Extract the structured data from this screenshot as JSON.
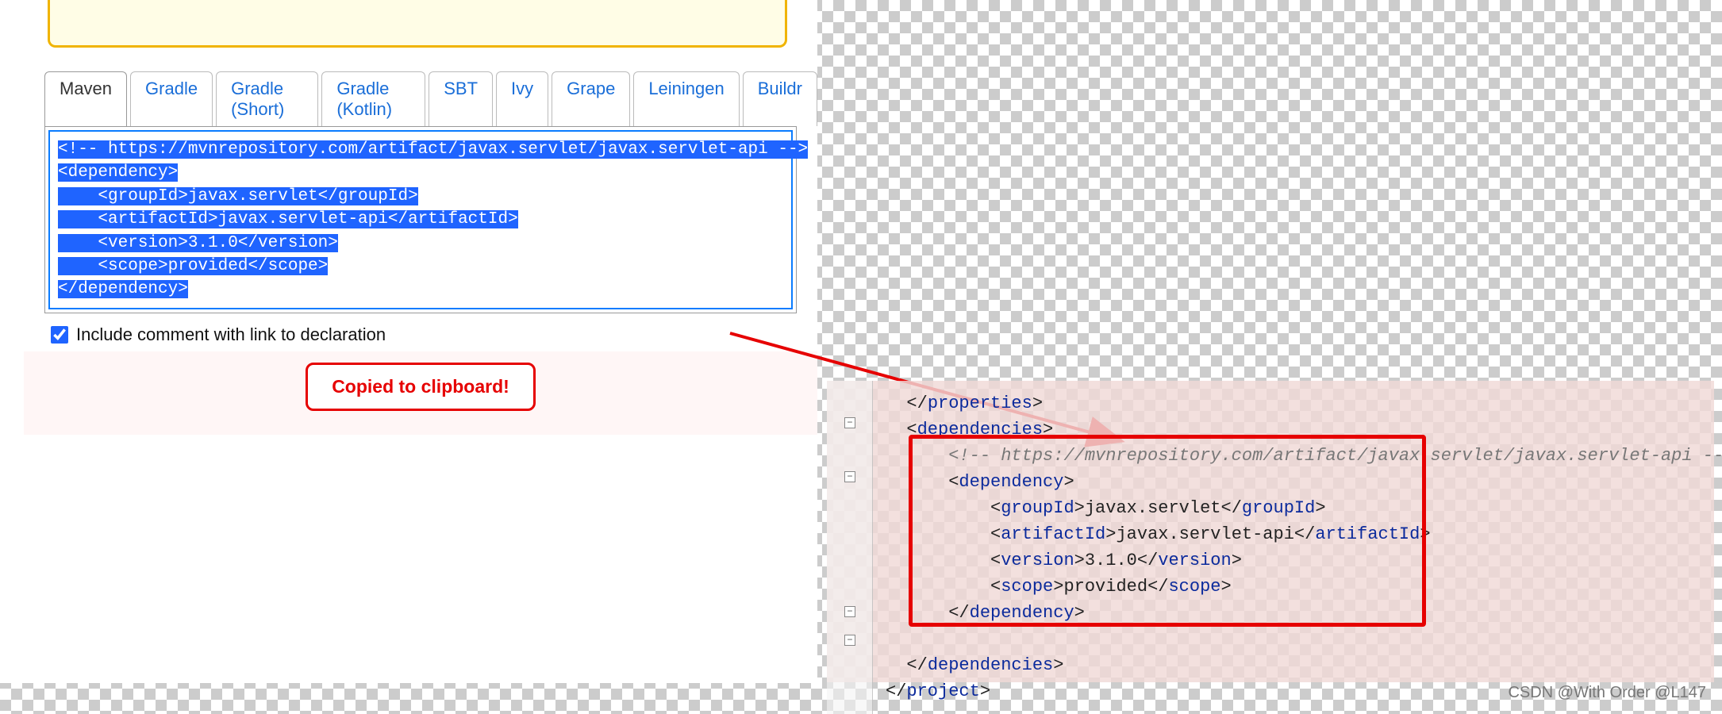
{
  "tabs": {
    "maven": "Maven",
    "gradle": "Gradle",
    "gradle_short": "Gradle (Short)",
    "gradle_kotlin": "Gradle (Kotlin)",
    "sbt": "SBT",
    "ivy": "Ivy",
    "grape": "Grape",
    "leiningen": "Leiningen",
    "buildr": "Buildr"
  },
  "snippet": {
    "l1": "<!-- https://mvnrepository.com/artifact/javax.servlet/javax.servlet-api -->",
    "l2": "<dependency>",
    "l3": "    <groupId>javax.servlet</groupId>",
    "l4": "    <artifactId>javax.servlet-api</artifactId>",
    "l5": "    <version>3.1.0</version>",
    "l6": "    <scope>provided</scope>",
    "l7": "</dependency>"
  },
  "checkbox_label": "Include comment with link to declaration",
  "copied_label": "Copied to clipboard!",
  "ide": {
    "properties_close": "properties",
    "dependencies_open": "dependencies",
    "comment": "<!-- https://mvnrepository.com/artifact/javax.servlet/javax.servlet-api -->",
    "dep_open": "dependency",
    "groupId_tag": "groupId",
    "groupId_val": "javax.servlet",
    "artifactId_tag": "artifactId",
    "artifactId_val": "javax.servlet-api",
    "version_tag": "version",
    "version_val": "3.1.0",
    "scope_tag": "scope",
    "scope_val": "provided",
    "dep_close": "dependency",
    "dependencies_close": "dependencies",
    "project_close": "project"
  },
  "watermark": "CSDN @With Order @L147"
}
